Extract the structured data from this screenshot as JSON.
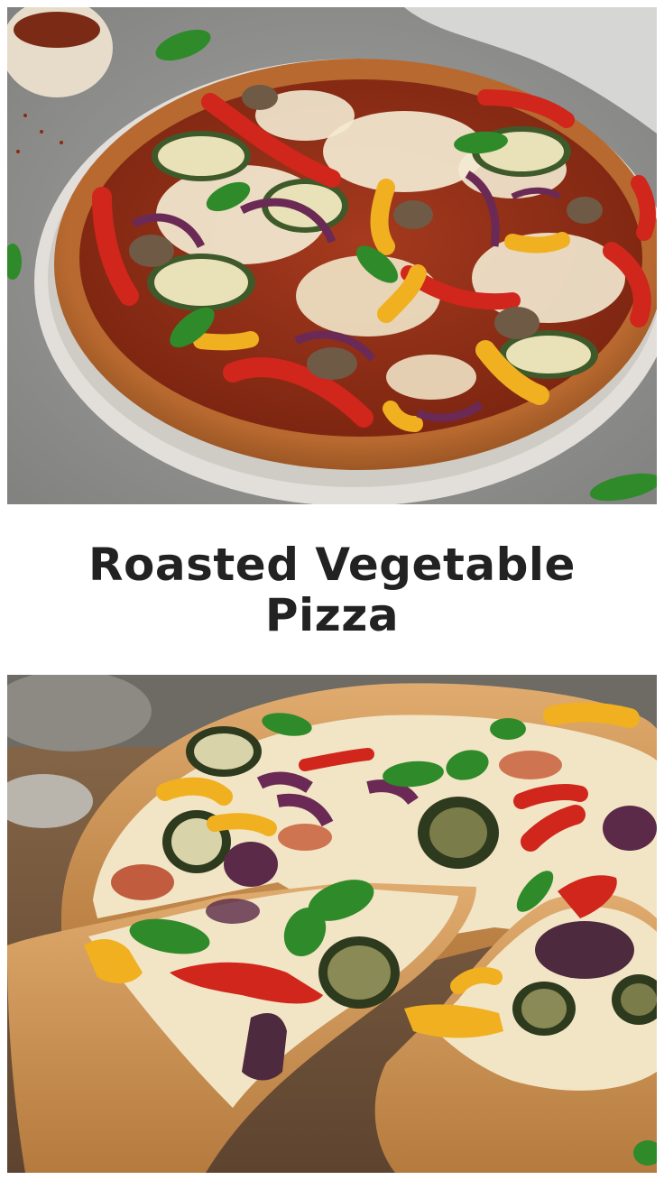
{
  "title": {
    "line1": "Roasted Vegetable",
    "line2": "Pizza"
  },
  "photos": {
    "top": "whole-pizza-photo",
    "bottom": "sliced-pizza-photo"
  },
  "colors": {
    "title_text": "#222222",
    "background": "#ffffff",
    "crust": "#c98a4a",
    "cheese": "#f3ead2",
    "red_pepper": "#d0261c",
    "yellow_pepper": "#f0b020",
    "zucchini": "#3f5a2a",
    "red_onion": "#6b2a55",
    "basil": "#2f8a2a"
  }
}
